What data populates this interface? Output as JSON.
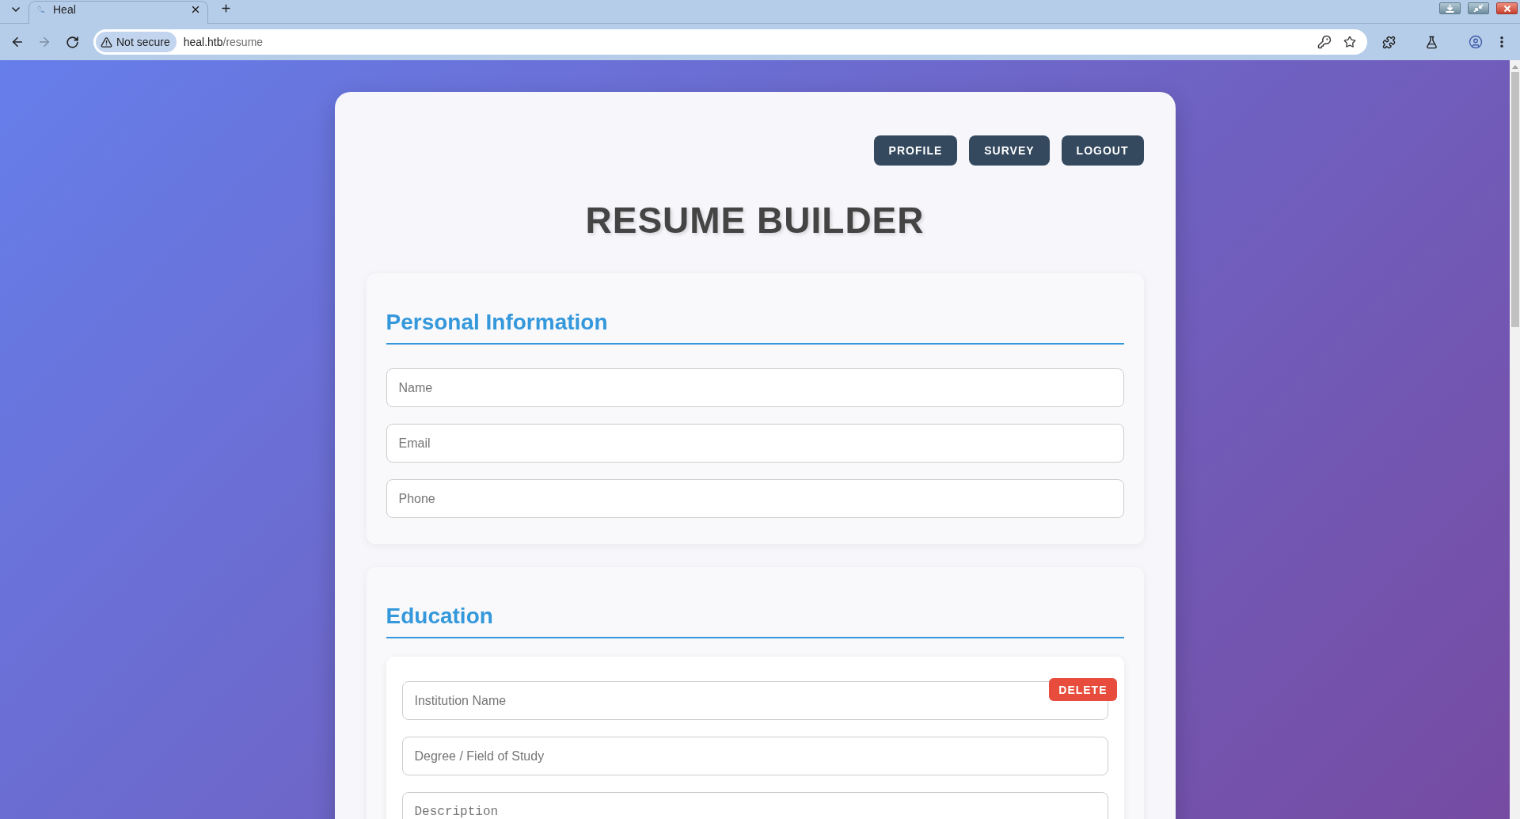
{
  "browser": {
    "tabs": [
      {
        "title": "Heal",
        "selected": true
      }
    ],
    "back_disabled": false,
    "forward_disabled": true,
    "address_bar": {
      "security_label": "Not secure",
      "domain": "heal.htb",
      "path": "/resume"
    }
  },
  "page": {
    "nav_buttons": [
      {
        "label": "PROFILE"
      },
      {
        "label": "SURVEY"
      },
      {
        "label": "LOGOUT"
      }
    ],
    "title": "RESUME BUILDER",
    "sections": [
      {
        "kind": "fields",
        "heading": "Personal Information",
        "fields": [
          {
            "kind": "input",
            "placeholder": "Name"
          },
          {
            "kind": "input",
            "placeholder": "Email"
          },
          {
            "kind": "input",
            "placeholder": "Phone"
          }
        ]
      },
      {
        "kind": "entries",
        "heading": "Education",
        "entries": [
          {
            "delete_label": "DELETE",
            "fields": [
              {
                "kind": "input",
                "placeholder": "Institution Name"
              },
              {
                "kind": "input",
                "placeholder": "Degree / Field of Study"
              },
              {
                "kind": "textarea",
                "placeholder": "Description"
              }
            ]
          }
        ]
      }
    ]
  }
}
